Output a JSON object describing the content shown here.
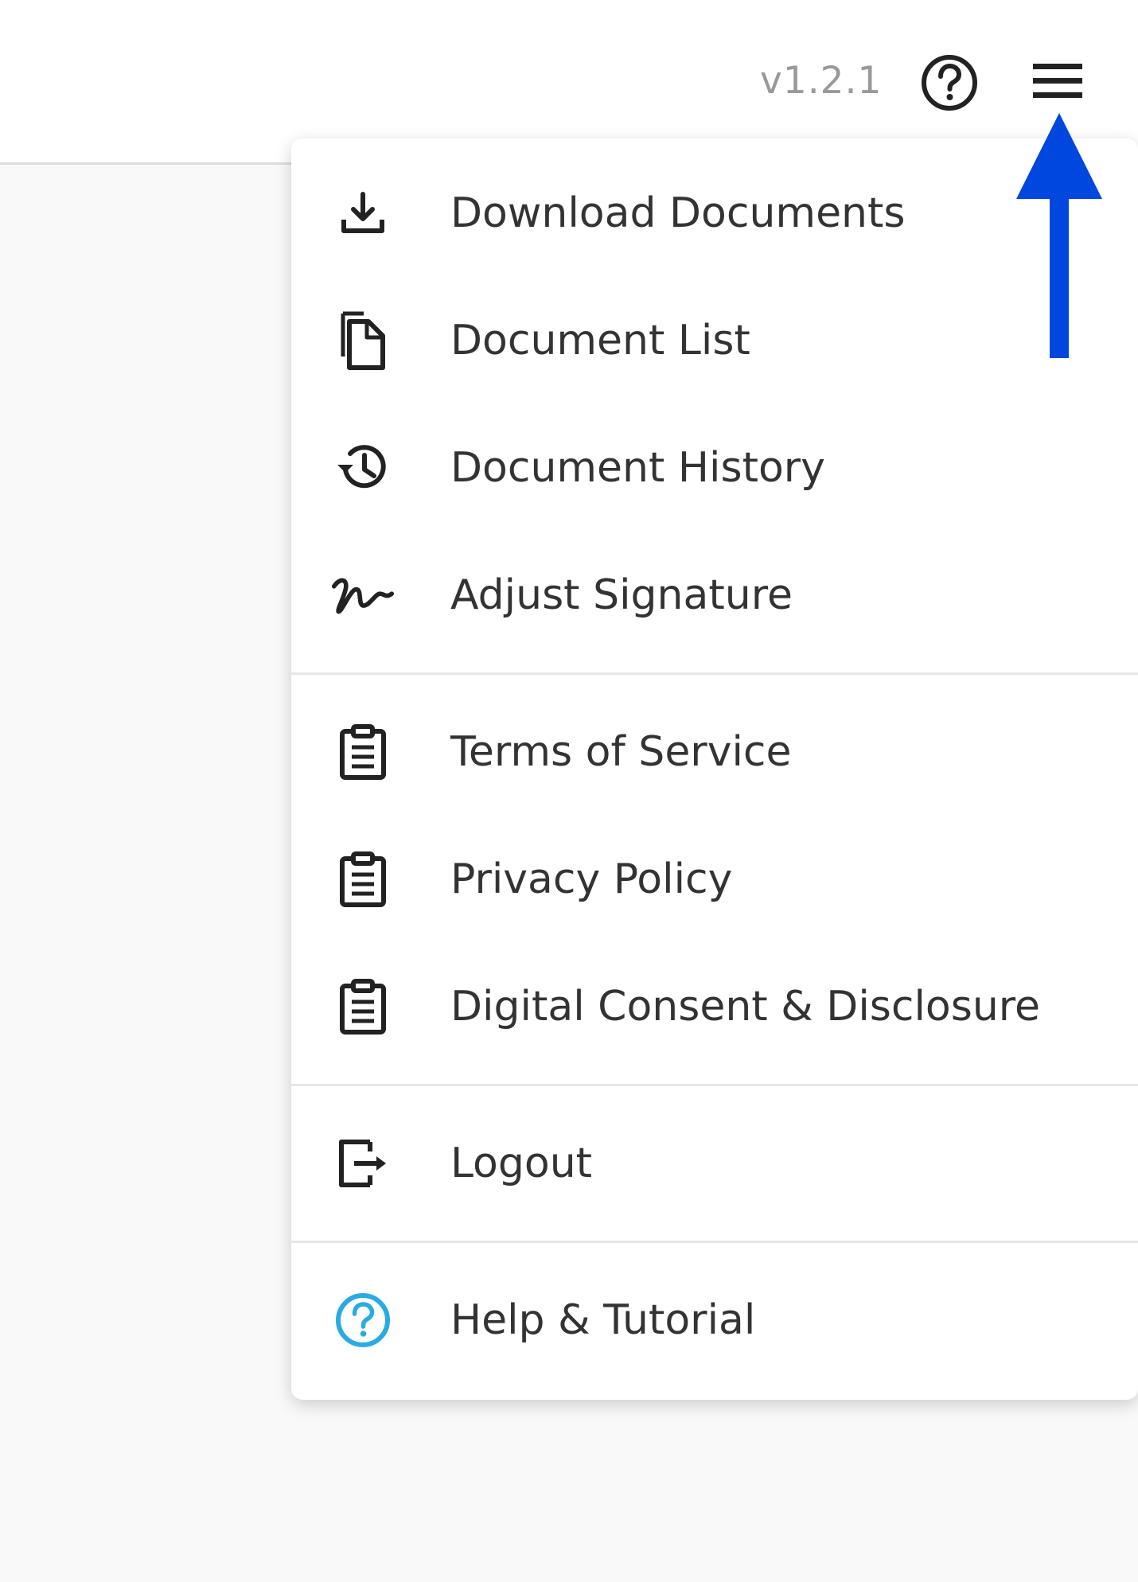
{
  "header": {
    "version": "v1.2.1",
    "help_icon": "question-circle-icon",
    "menu_icon": "hamburger-menu-icon"
  },
  "menu": {
    "groups": [
      [
        {
          "label": "Download Documents",
          "icon": "download-icon"
        },
        {
          "label": "Document List",
          "icon": "copy-documents-icon"
        },
        {
          "label": "Document History",
          "icon": "history-clock-icon"
        },
        {
          "label": "Adjust Signature",
          "icon": "signature-icon"
        }
      ],
      [
        {
          "label": "Terms of Service",
          "icon": "clipboard-icon"
        },
        {
          "label": "Privacy Policy",
          "icon": "clipboard-icon"
        },
        {
          "label": "Digital Consent & Disclosure",
          "icon": "clipboard-icon"
        }
      ],
      [
        {
          "label": "Logout",
          "icon": "logout-icon"
        }
      ],
      [
        {
          "label": "Help & Tutorial",
          "icon": "help-circle-icon"
        }
      ]
    ]
  },
  "annotation": {
    "arrow_color": "#0047e0",
    "arrow_icon": "up-arrow-icon"
  },
  "colors": {
    "text": "#333333",
    "muted": "#999999",
    "help_accent": "#29abe2"
  }
}
